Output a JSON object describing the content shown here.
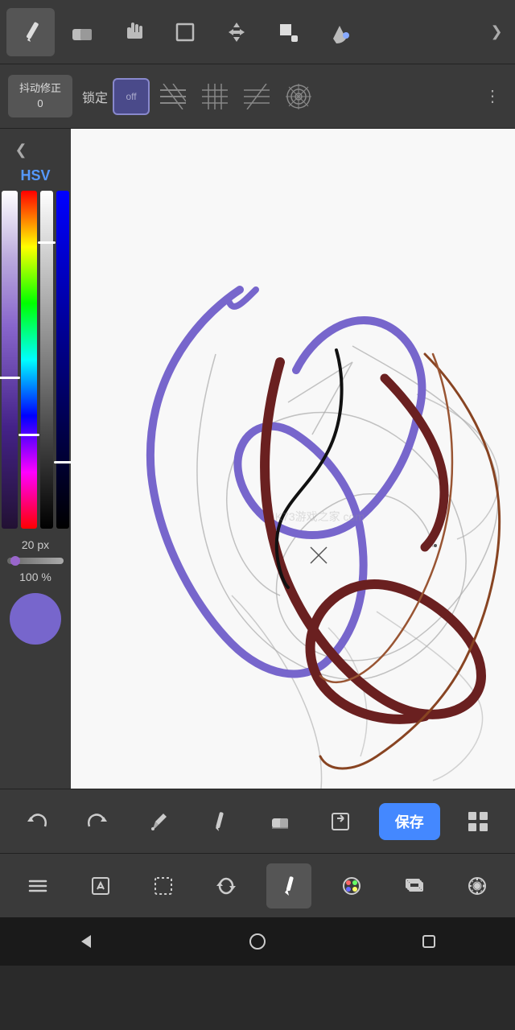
{
  "toolbar": {
    "tools": [
      {
        "name": "pencil",
        "icon": "✏️",
        "active": true
      },
      {
        "name": "eraser",
        "icon": "⬜",
        "active": false
      },
      {
        "name": "hand",
        "icon": "✋",
        "active": false
      },
      {
        "name": "selection",
        "icon": "⬜",
        "active": false
      },
      {
        "name": "move",
        "icon": "✛",
        "active": false
      },
      {
        "name": "color-fill",
        "icon": "⬜",
        "active": false
      },
      {
        "name": "bucket",
        "icon": "⬤",
        "active": false
      }
    ],
    "expand_icon": "❯"
  },
  "second_toolbar": {
    "shake_correct_label": "抖动修正",
    "shake_correct_value": "0",
    "lock_label": "锁定",
    "lock_off_label": "off",
    "patterns": [
      "diagonal1",
      "grid",
      "diagonal2",
      "radial",
      "spiral"
    ],
    "more_icon": "⋮"
  },
  "left_panel": {
    "collapse_icon": "❮",
    "hsv_label": "HSV",
    "brush_size_label": "20 px",
    "opacity_label": "100 %"
  },
  "bottom_toolbar_1": {
    "undo_icon": "↩",
    "redo_icon": "↪",
    "dropper_icon": "💉",
    "pen_icon": "✒",
    "eraser_icon": "⬜",
    "export_icon": "⬜",
    "save_label": "保存",
    "grid_icon": "⊞"
  },
  "bottom_toolbar_2": {
    "menu_icon": "☰",
    "edit_icon": "✏",
    "select_icon": "⬚",
    "rotate_icon": "↻",
    "brush_icon": "✏",
    "palette_icon": "🎨",
    "layers_icon": "⬜",
    "settings_icon": "⚙"
  },
  "system_nav": {
    "back_icon": "◁",
    "home_icon": "○",
    "recent_icon": "□"
  },
  "watermark": "K73游戏之家\ncom"
}
